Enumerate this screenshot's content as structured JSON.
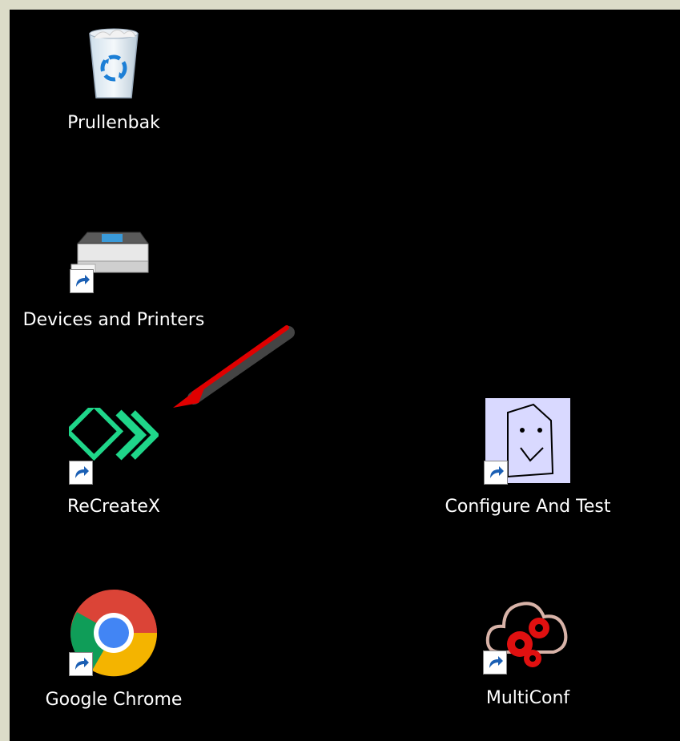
{
  "desktop": {
    "background": "#000000",
    "frame_color": "#dcdcc8",
    "icons": [
      {
        "id": "recycle-bin",
        "label": "Prullenbak",
        "icon": "recycle-bin-icon",
        "shortcut": false
      },
      {
        "id": "devices-printers",
        "label": "Devices and Printers",
        "icon": "printer-icon",
        "shortcut": true
      },
      {
        "id": "recreatex",
        "label": "ReCreateX",
        "icon": "recreatex-logo-icon",
        "shortcut": true,
        "accent": "#1fd68a"
      },
      {
        "id": "configure-test",
        "label": "Configure And Test",
        "icon": "smiley-tag-icon",
        "shortcut": true
      },
      {
        "id": "chrome",
        "label": "Google Chrome",
        "icon": "chrome-icon",
        "shortcut": true
      },
      {
        "id": "multiconf",
        "label": "MultiConf",
        "icon": "cloud-gears-icon",
        "shortcut": true,
        "accent": "#e01010"
      }
    ]
  },
  "annotation": {
    "arrow_color": "#e00000",
    "points_to": "recreatex"
  }
}
